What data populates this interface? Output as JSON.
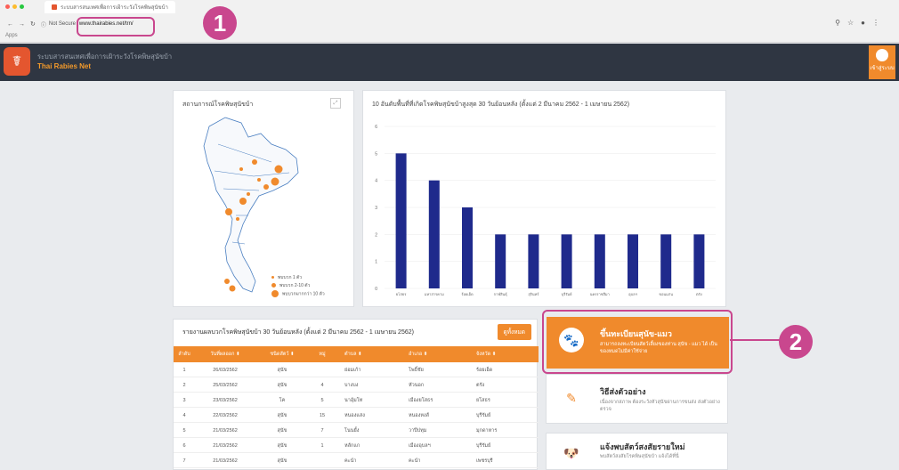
{
  "browser": {
    "tab_title": "ระบบสารสนเทศเพื่อการเฝ้าระวังโรคพิษสุนัขบ้า",
    "not_secure": "Not Secure",
    "url": "www.thairabies.net/trn/",
    "bookmark": "Apps"
  },
  "markers": [
    "1",
    "2"
  ],
  "header": {
    "subtitle": "ระบบสารสนเทศเพื่อการเฝ้าระวังโรคพิษสุนัขบ้า",
    "title": "Thai Rabies Net",
    "user_label": "เข้าสู่ระบบ"
  },
  "map": {
    "title": "สถานการณ์โรคพิษสุนัขบ้า",
    "legend": [
      "พบบวก 1 ตัว",
      "พบบวก 2-10 ตัว",
      "พบบวกมากกว่า 10 ตัว"
    ],
    "accent": "#f08a2c"
  },
  "chart_data": {
    "type": "bar",
    "title": "10 อันดับพื้นที่ที่เกิดโรคพิษสุนัขบ้าสูงสุด 30 วันย้อนหลัง (ตั้งแต่ 2 มีนาคม 2562 - 1 เมษายน 2562)",
    "categories": [
      "ยโสธร",
      "มหาสารคาม",
      "ร้อยเอ็ด",
      "กาฬสินธุ์",
      "สุรินทร์",
      "บุรีรัมย์",
      "นครราชสีมา",
      "อุบลฯ",
      "ขอนแก่น",
      "ตรัง"
    ],
    "values": [
      5,
      4,
      3,
      2,
      2,
      2,
      2,
      2,
      2,
      2
    ],
    "ylim": [
      0,
      6
    ],
    "yticks": [
      0,
      1,
      2,
      3,
      4,
      5,
      6
    ],
    "color": "#1f2a8c"
  },
  "table": {
    "title": "รายงานผลบวกโรคพิษสุนัขบ้า 30 วันย้อนหลัง (ตั้งแต่ 2 มีนาคม 2562 - 1 เมษายน 2562)",
    "all_button": "ดูทั้งหมด",
    "headers": [
      "ลำดับ",
      "วันที่ผลออก",
      "ชนิดสัตว์",
      "หมู่",
      "ตำบล",
      "อำเภอ",
      "จังหวัด"
    ],
    "rows": [
      [
        "1",
        "26/03/2562",
        "สุนัข",
        "",
        "ย่อมเก้า",
        "โพธิ์ชัย",
        "ร้อยเอ็ด"
      ],
      [
        "2",
        "25/03/2562",
        "สุนัข",
        "4",
        "บางบง",
        "หัวนอก",
        "ตรัง"
      ],
      [
        "3",
        "23/03/2562",
        "โค",
        "5",
        "นาอุ้มโท",
        "เมืองยโสธร",
        "ยโสธร"
      ],
      [
        "4",
        "22/03/2562",
        "สุนัข",
        "15",
        "หนองแสง",
        "หนองหงส์",
        "บุรีรัมย์"
      ],
      [
        "5",
        "21/03/2562",
        "สุนัข",
        "7",
        "โนนยั้ง",
        "วาปีปทุม",
        "มุกดาหาร"
      ],
      [
        "6",
        "21/03/2562",
        "สุนัข",
        "1",
        "หลักแก",
        "เมืองอุบลฯ",
        "บุรีรัมย์"
      ],
      [
        "7",
        "21/03/2562",
        "สุนัข",
        "",
        "คะนำ",
        "คะนำ",
        "เพชรบุรี"
      ]
    ]
  },
  "features": [
    {
      "title": "ขึ้นทะเบียนสุนัข-แมว",
      "desc": "สามารถลงทะเบียนสัตว์เลี้ยงของท่าน สุนัข - แมว ได้ เป็นของหมดไม่มีค่าใช้จ่าย",
      "icon": "dog-cat-icon"
    },
    {
      "title": "วิธีส่งตัวอย่าง",
      "desc": "เนื่องจากสภาพ ต้องระวังหัวสุนัขผ่านการขนส่ง ส่งตัวอย่างตรวจ",
      "icon": "syringe-icon"
    },
    {
      "title": "แจ้งพบสัตว์สงสัยรายใหม่",
      "desc": "พบสัตว์สงสัยโรคพิษสุนัขบ้า แจ้งได้ที่นี่",
      "icon": "dog-icon"
    }
  ]
}
